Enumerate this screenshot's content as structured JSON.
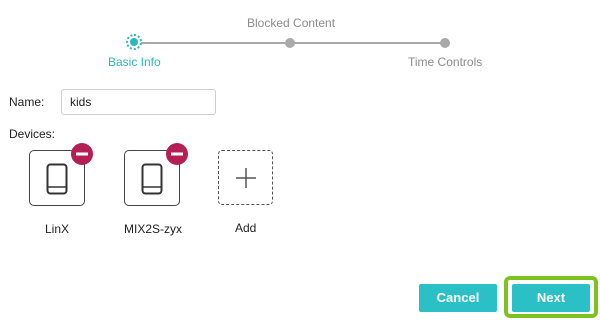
{
  "stepper": {
    "steps": [
      {
        "label": "Basic Info",
        "state": "active"
      },
      {
        "label": "Blocked Content",
        "state": "pending"
      },
      {
        "label": "Time Controls",
        "state": "pending"
      }
    ]
  },
  "form": {
    "name_label": "Name:",
    "name_value": "kids",
    "devices_label": "Devices:"
  },
  "devices": [
    {
      "name": "LinX",
      "icon": "phone-icon",
      "remove_icon": "minus-icon"
    },
    {
      "name": "MIX2S-zyx",
      "icon": "phone-icon",
      "remove_icon": "minus-icon"
    }
  ],
  "add_device": {
    "label": "Add",
    "icon": "plus-icon"
  },
  "buttons": {
    "cancel": "Cancel",
    "next": "Next"
  },
  "colors": {
    "accent": "#2bc0c6",
    "active_step": "#2bb6c1",
    "remove_badge": "#b51d55",
    "highlight": "#7dc21e",
    "inactive_step": "#a9a9a9"
  }
}
